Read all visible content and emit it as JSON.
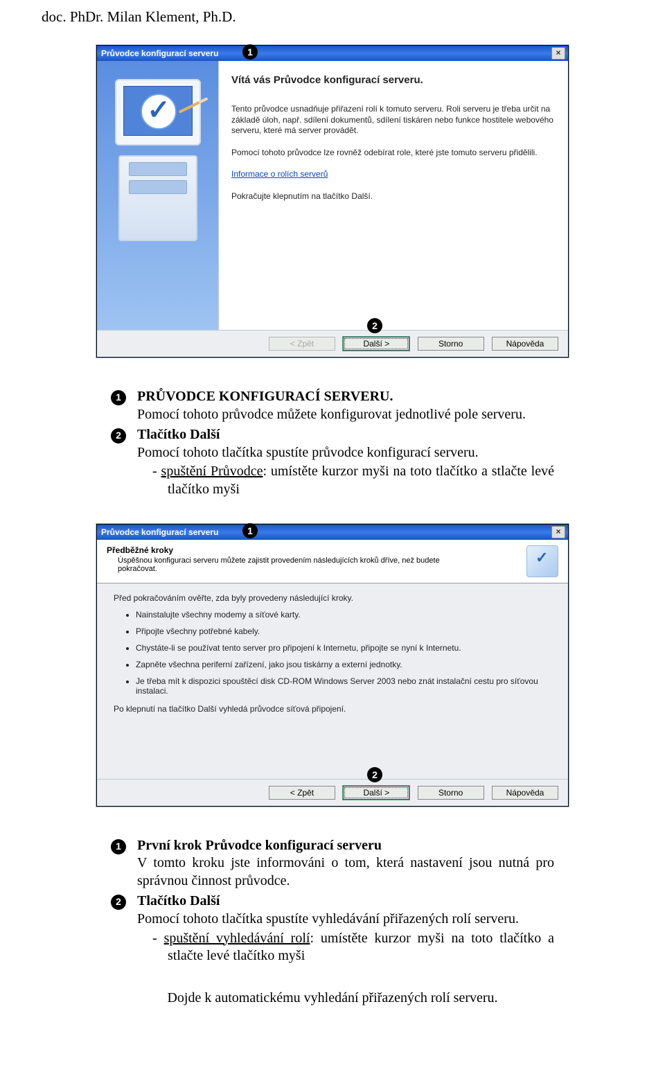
{
  "author": "doc. PhDr. Milan Klement, Ph.D.",
  "wizard1": {
    "title": "Průvodce konfigurací serveru",
    "heading": "Vítá vás Průvodce konfigurací serveru.",
    "para1": "Tento průvodce usnadňuje přiřazení rolí k tomuto serveru. Roli serveru je třeba určit na základě úloh, např. sdílení dokumentů, sdílení tiskáren nebo funkce hostitele webového serveru, které má server provádět.",
    "para2": "Pomocí tohoto průvodce lze rovněž odebírat role, které jste tomuto serveru přidělili.",
    "link": "Informace o rolích serverů",
    "para3": "Pokračujte klepnutím na tlačítko Další.",
    "buttons": {
      "back": "< Zpět",
      "next": "Další >",
      "cancel": "Storno",
      "help": "Nápověda"
    }
  },
  "info1": {
    "row1_line1_bold": "PRŮVODCE KONFIGURACÍ SERVERU.",
    "row1_line2": "Pomocí tohoto průvodce můžete konfigurovat jednotlivé pole serveru.",
    "row2_line1_bold": "Tlačítko Další",
    "row2_line2": "Pomocí tohoto tlačítka spustíte průvodce konfigurací serveru.",
    "row2_bullet_pfx": "-   ",
    "row2_bullet_u": "spuštění Průvodce",
    "row2_bullet_rest": ": umístěte kurzor myši na toto tlačítko a stlačte levé tlačítko myši"
  },
  "wizard2": {
    "title": "Průvodce konfigurací serveru",
    "head_bold": "Předběžné kroky",
    "head_sub": "Úspěšnou konfiguraci serveru můžete zajistit provedením následujících kroků dříve, než budete pokračovat.",
    "intro": "Před pokračováním ověřte, zda byly provedeny následující kroky.",
    "items": [
      "Nainstalujte všechny modemy a síťové karty.",
      "Připojte všechny potřebné kabely.",
      "Chystáte-li se používat tento server pro připojení k Internetu, připojte se nyní k Internetu.",
      "Zapněte všechna periferní zařízení, jako jsou tiskárny a externí jednotky.",
      "Je třeba mít k dispozici spouštěcí disk CD-ROM Windows Server 2003 nebo znát instalační cestu pro síťovou instalaci."
    ],
    "outro": "Po klepnutí na tlačítko Další vyhledá průvodce síťová připojení.",
    "buttons": {
      "back": "< Zpět",
      "next": "Další >",
      "cancel": "Storno",
      "help": "Nápověda"
    }
  },
  "info2": {
    "row1_line1_bold": "První krok Průvodce konfigurací serveru",
    "row1_line2": "V tomto kroku jste informováni o tom, která nastavení jsou nutná pro správnou činnost průvodce.",
    "row2_line1_bold": "Tlačítko Další",
    "row2_line2": "Pomocí tohoto tlačítka spustíte vyhledávání přiřazených rolí serveru.",
    "row2_bullet_pfx": "-   ",
    "row2_bullet_u": "spuštění vyhledávání rolí",
    "row2_bullet_rest": ": umístěte kurzor myši na toto tlačítko a stlačte levé tlačítko myši"
  },
  "bottom_note": "Dojde k automatickému vyhledání přiřazených rolí serveru."
}
